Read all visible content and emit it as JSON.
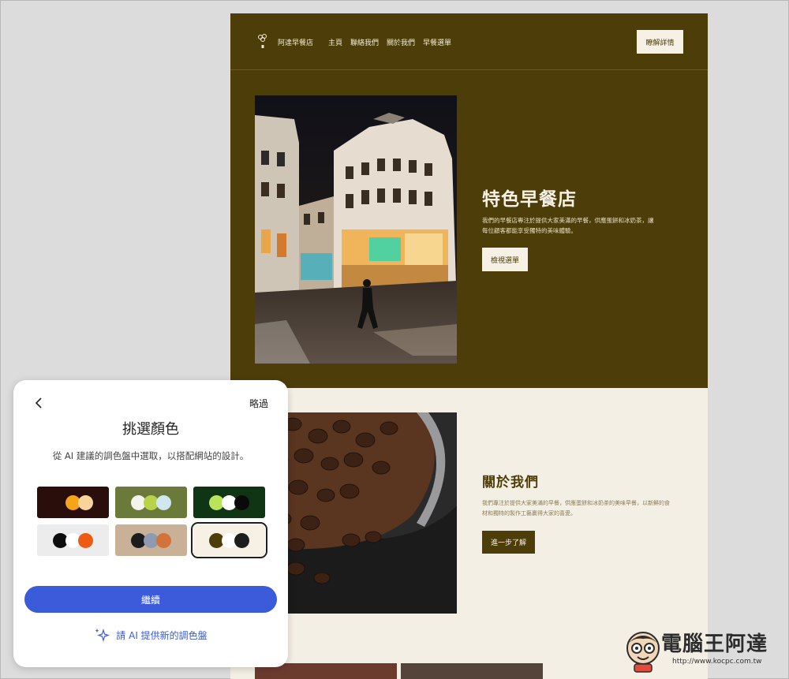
{
  "site": {
    "brand": "阿達早餐店",
    "nav": [
      "主頁",
      "聯絡我們",
      "關於我們",
      "早餐選單"
    ],
    "header_button": "瞭解詳情",
    "hero": {
      "title": "特色早餐店",
      "text": "我們的早餐店專注於提供大家美滿的早餐，供應蛋餅和冰奶茶，讓每位顧客都能享受獨特的美味體驗。",
      "button": "檢視選單"
    },
    "about": {
      "title": "關於我們",
      "text": "我們專注於提供大家美滿的早餐，供應蛋餅和冰奶茶的美味早餐，以新鮮的食材和獨特的製作工藝贏得大家的喜愛。",
      "button": "進一步了解"
    }
  },
  "panel": {
    "skip": "略過",
    "title": "挑選顏色",
    "subtitle": "從 AI 建議的調色盤中選取，以搭配網站的設計。",
    "continue": "繼續",
    "ai_link": "請 AI 提供新的調色盤"
  },
  "palettes": [
    {
      "bg": "#2a0e0b",
      "dots": [
        "#2a0e0b",
        "#f5a51c",
        "#f7d59a"
      ],
      "selected": false
    },
    {
      "bg": "#6b7a3a",
      "dots": [
        "#f4f4ee",
        "#b8d24a",
        "#cfe8ef"
      ],
      "selected": false
    },
    {
      "bg": "#0f3514",
      "dots": [
        "#b8e35a",
        "#ffffff",
        "#0a0a0a"
      ],
      "selected": false
    },
    {
      "bg": "#ececec",
      "dots": [
        "#0d0d0d",
        "#ffffff",
        "#ef5a12"
      ],
      "selected": false
    },
    {
      "bg": "#c8b196",
      "dots": [
        "#1c1c1c",
        "#8d9ab0",
        "#d1733a"
      ],
      "selected": false
    },
    {
      "bg": "#f6f1e4",
      "dots": [
        "#4d3d08",
        "#ffffff",
        "#1d1d1d"
      ],
      "selected": true
    }
  ],
  "watermark": {
    "text": "電腦王阿達",
    "url": "http://www.kocpc.com.tw"
  }
}
